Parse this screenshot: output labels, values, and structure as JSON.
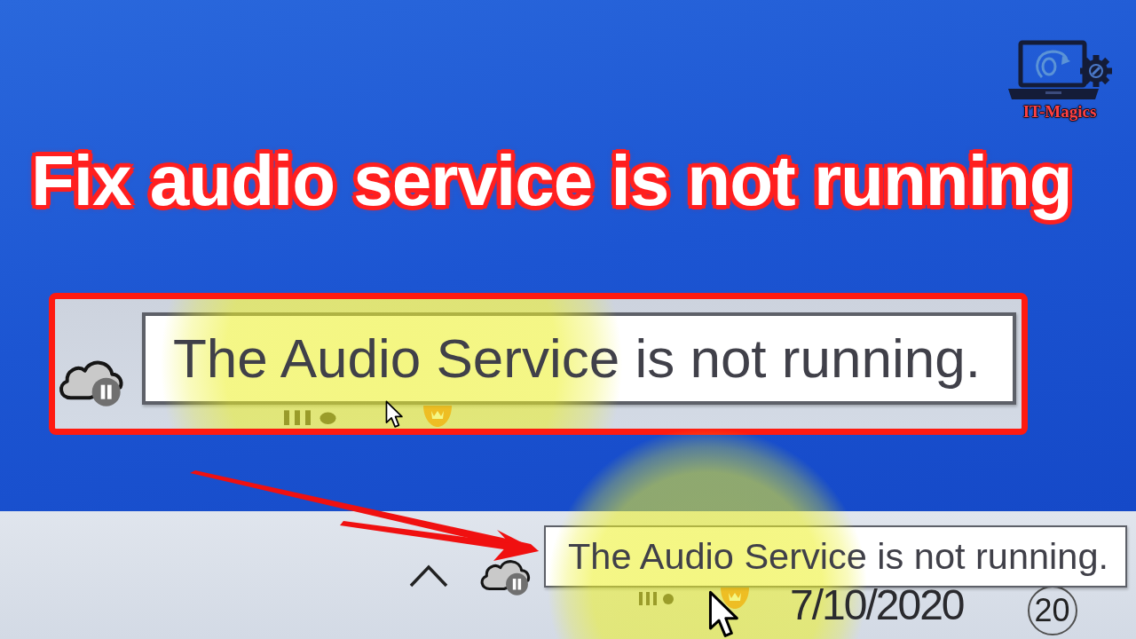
{
  "logo": {
    "text": "IT-Magics"
  },
  "title": "Fix audio service is not running",
  "inset": {
    "tooltip": "The Audio Service is not running."
  },
  "taskbar": {
    "tooltip": "The Audio Service is not running.",
    "date": "7/10/2020",
    "time": "20"
  }
}
